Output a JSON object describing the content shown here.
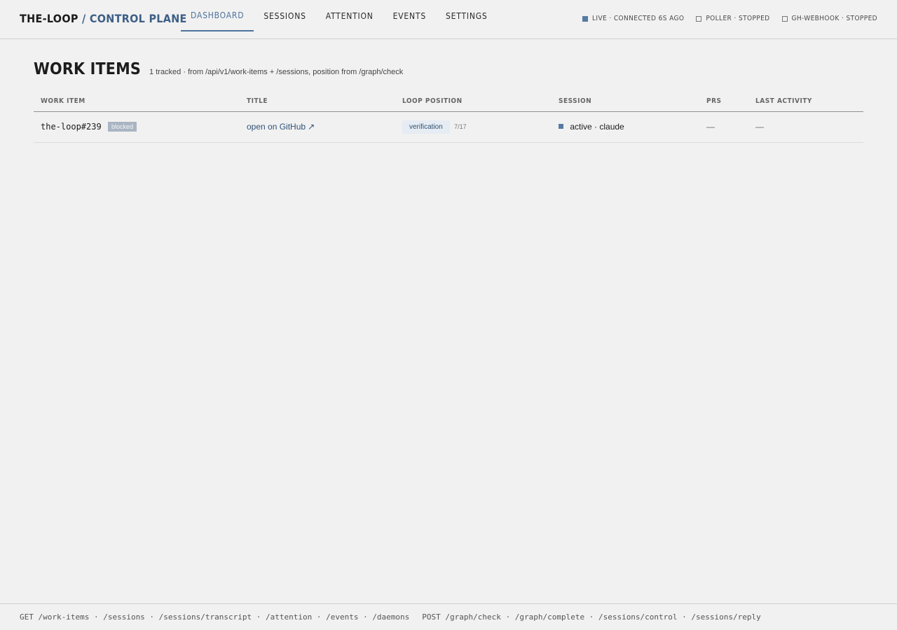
{
  "brand": {
    "main": "THE-LOOP",
    "sub": "/ CONTROL PLANE"
  },
  "nav": {
    "tabs": [
      {
        "label": "DASHBOARD",
        "active": true
      },
      {
        "label": "SESSIONS",
        "active": false
      },
      {
        "label": "ATTENTION",
        "active": false
      },
      {
        "label": "EVENTS",
        "active": false
      },
      {
        "label": "SETTINGS",
        "active": false
      }
    ]
  },
  "status": {
    "live": "LIVE · CONNECTED 6S AGO",
    "poller": "POLLER · STOPPED",
    "webhook": "GH-WEBHOOK · STOPPED"
  },
  "main": {
    "title": "WORK ITEMS",
    "subtitle": "1 tracked · from /api/v1/work-items + /sessions, position from /graph/check"
  },
  "table": {
    "headers": {
      "work_item": "WORK ITEM",
      "title": "TITLE",
      "loop_position": "LOOP POSITION",
      "session": "SESSION",
      "prs": "PRS",
      "last_activity": "LAST ACTIVITY"
    },
    "rows": [
      {
        "work_item": "the-loop#239",
        "badge": "blocked",
        "title_link": "open on GitHub",
        "title_icon": "↗",
        "position": "verification",
        "position_count": "7/17",
        "session": "active · claude",
        "prs": "—",
        "last_activity": "—"
      }
    ]
  },
  "footer": {
    "get": "GET /work-items · /sessions · /sessions/transcript · /attention · /events · /daemons",
    "post": "POST /graph/check · /graph/complete · /sessions/control · /sessions/reply"
  },
  "colors": {
    "accent": "#4d739c",
    "background": "#f1f1f1",
    "badge": "#a9b5c2",
    "pill": "#e6ecf3"
  },
  "icons": {
    "live_indicator": "filled-square-icon",
    "stopped_indicator": "empty-square-icon",
    "external_link": "arrow-up-right-icon"
  }
}
